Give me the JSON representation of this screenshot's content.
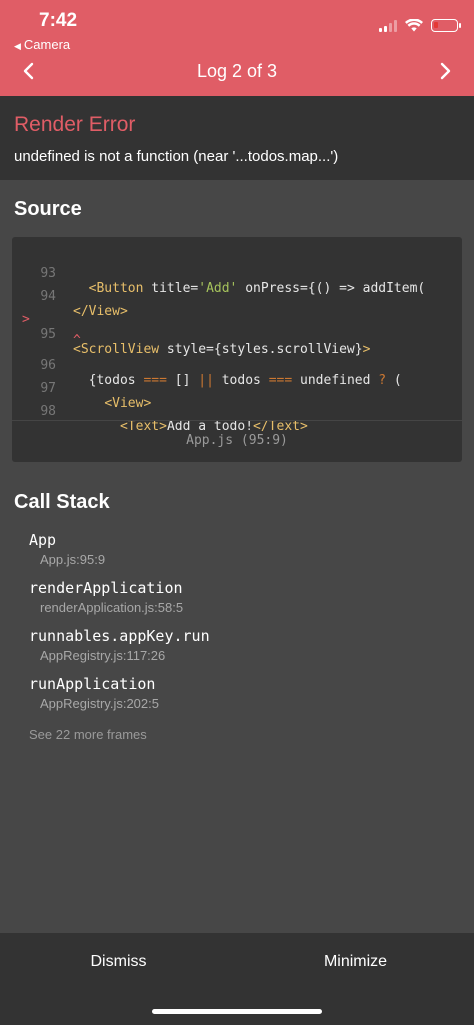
{
  "status_bar": {
    "time": "7:42",
    "back_app": "Camera",
    "battery_color": "#e53935"
  },
  "header": {
    "title": "Log 2 of 3",
    "prev_icon": "chevron-left-icon",
    "next_icon": "chevron-right-icon",
    "background": "#e05d66"
  },
  "error": {
    "title": "Render Error",
    "message": "undefined is not a function (near '...todos.map...')"
  },
  "source": {
    "title": "Source",
    "lines": [
      {
        "number": "93",
        "text": "<Button title='Add' onPress={() => addItem("
      },
      {
        "number": "94",
        "text": "</View>"
      },
      {
        "number": "95",
        "marker": ">",
        "text": "<ScrollView style={styles.scrollView}>"
      },
      {
        "caret": "^"
      },
      {
        "number": "96",
        "text": "{todos === [] || todos === undefined ? ("
      },
      {
        "number": "97",
        "text": "<View>"
      },
      {
        "number": "98",
        "text": "<Text>Add a todo!</Text>"
      }
    ],
    "file": "App.js (95:9)"
  },
  "call_stack": {
    "title": "Call Stack",
    "frames": [
      {
        "name": "App",
        "location": "App.js:95:9"
      },
      {
        "name": "renderApplication",
        "location": "renderApplication.js:58:5"
      },
      {
        "name": "runnables.appKey.run",
        "location": "AppRegistry.js:117:26"
      },
      {
        "name": "runApplication",
        "location": "AppRegistry.js:202:5"
      }
    ],
    "more": "See 22 more frames"
  },
  "footer": {
    "dismiss": "Dismiss",
    "minimize": "Minimize"
  }
}
